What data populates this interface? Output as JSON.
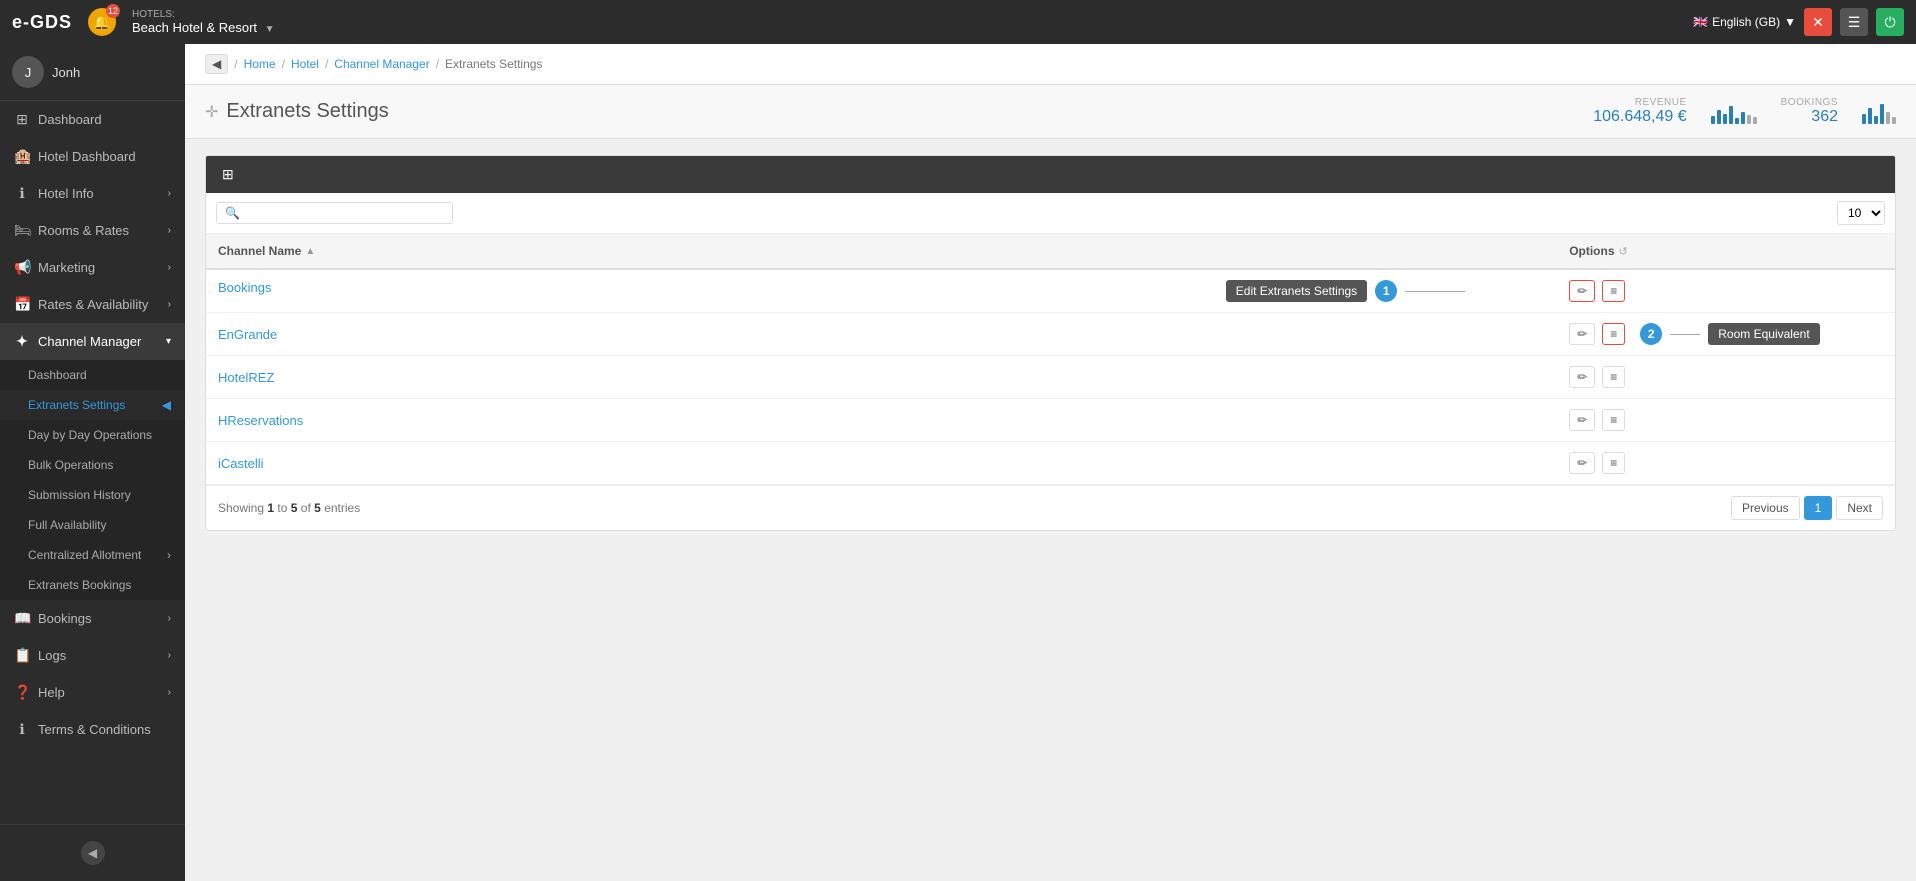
{
  "app": {
    "brand": "e-GDS",
    "notification_count": "12"
  },
  "top_nav": {
    "hotels_label": "HOTELS:",
    "hotel_name": "Beach Hotel & Resort",
    "language": "English (GB)",
    "flag_emoji": "🇬🇧"
  },
  "sidebar": {
    "username": "Jonh",
    "items": [
      {
        "id": "dashboard",
        "label": "Dashboard",
        "icon": "⊞",
        "has_sub": false
      },
      {
        "id": "hotel-dashboard",
        "label": "Hotel Dashboard",
        "icon": "🏨",
        "has_sub": false
      },
      {
        "id": "hotel-info",
        "label": "Hotel Info",
        "icon": "ℹ",
        "has_sub": true
      },
      {
        "id": "rooms-rates",
        "label": "Rooms & Rates",
        "icon": "🛏",
        "has_sub": true
      },
      {
        "id": "marketing",
        "label": "Marketing",
        "icon": "📢",
        "has_sub": true
      },
      {
        "id": "rates-availability",
        "label": "Rates & Availability",
        "icon": "📅",
        "has_sub": true
      },
      {
        "id": "channel-manager",
        "label": "Channel Manager",
        "icon": "+",
        "has_sub": true,
        "active": true
      },
      {
        "id": "bookings",
        "label": "Bookings",
        "icon": "📖",
        "has_sub": true
      },
      {
        "id": "logs",
        "label": "Logs",
        "icon": "📋",
        "has_sub": true
      },
      {
        "id": "help",
        "label": "Help",
        "icon": "?",
        "has_sub": true
      },
      {
        "id": "terms",
        "label": "Terms & Conditions",
        "icon": "ℹ",
        "has_sub": false
      }
    ],
    "channel_manager_sub": [
      {
        "id": "cm-dashboard",
        "label": "Dashboard",
        "active": false
      },
      {
        "id": "cm-extranets",
        "label": "Extranets Settings",
        "active": true
      },
      {
        "id": "cm-day-by-day",
        "label": "Day by Day Operations",
        "active": false
      },
      {
        "id": "cm-bulk",
        "label": "Bulk Operations",
        "active": false
      },
      {
        "id": "cm-submission",
        "label": "Submission History",
        "active": false
      },
      {
        "id": "cm-full-avail",
        "label": "Full Availability",
        "active": false
      },
      {
        "id": "cm-centralized",
        "label": "Centralized Allotment",
        "active": false,
        "has_sub": true
      },
      {
        "id": "cm-ext-bookings",
        "label": "Extranets Bookings",
        "active": false
      }
    ]
  },
  "breadcrumb": {
    "items": [
      "Home",
      "Hotel",
      "Channel Manager",
      "Extranets Settings"
    ]
  },
  "page": {
    "title": "Extranets Settings",
    "revenue_label": "REVENUE",
    "revenue_value": "106.648,49 €",
    "bookings_label": "BOOKINGS",
    "bookings_value": "362"
  },
  "table": {
    "search_placeholder": "",
    "per_page": "10",
    "col_channel_name": "Channel Name",
    "col_options": "Options",
    "rows": [
      {
        "id": "bookings-row",
        "channel": "Bookings",
        "tooltip": "Edit Extranets Settings",
        "tooltip_num": "1"
      },
      {
        "id": "engrande-row",
        "channel": "EnGrande",
        "tooltip": "Room Equivalent",
        "tooltip_num": "2"
      },
      {
        "id": "hotelrez-row",
        "channel": "HotelREZ",
        "tooltip": "",
        "tooltip_num": ""
      },
      {
        "id": "hreservations-row",
        "channel": "HReservations",
        "tooltip": "",
        "tooltip_num": ""
      },
      {
        "id": "icastelli-row",
        "channel": "iCastelli",
        "tooltip": "",
        "tooltip_num": ""
      }
    ],
    "showing_prefix": "Showing",
    "showing_from": "1",
    "showing_to": "5",
    "showing_of": "5",
    "showing_suffix": "entries",
    "btn_previous": "Previous",
    "btn_next": "Next",
    "current_page": "1"
  }
}
